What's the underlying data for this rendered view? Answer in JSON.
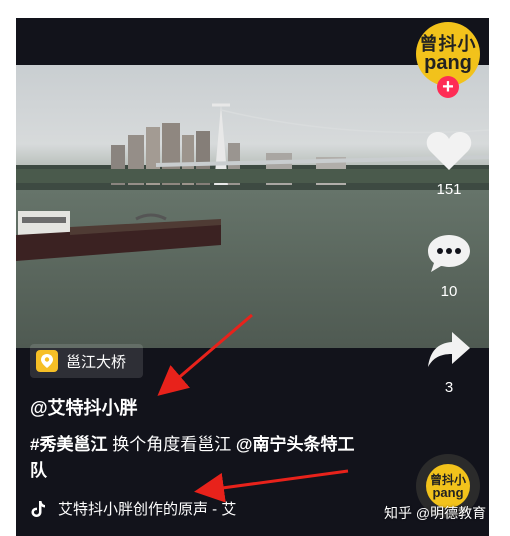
{
  "creator": {
    "avatar_text_top": "曾抖小",
    "avatar_text_bottom": "pang",
    "follow_symbol": "+"
  },
  "actions": {
    "like": {
      "icon": "heart-icon",
      "count": "151"
    },
    "comment": {
      "icon": "comment-icon",
      "count": "10"
    },
    "share": {
      "icon": "share-icon",
      "count": "3"
    }
  },
  "location": {
    "icon": "location-pin-icon",
    "label": "邕江大桥"
  },
  "author_handle": "@艾特抖小胖",
  "description": {
    "hashtag": "#秀美邕江",
    "text": " 换个角度看邕江 ",
    "mention": "@南宁头条特工队"
  },
  "music": {
    "icon": "tiktok-note-icon",
    "label": "艾特抖小胖创作的原声 - 艾"
  },
  "watermark": "知乎 @明德教育",
  "colors": {
    "background": "#12131b",
    "accent": "#fe2c55",
    "arrow": "#e8221b",
    "brand_yellow": "#f2c21b"
  }
}
